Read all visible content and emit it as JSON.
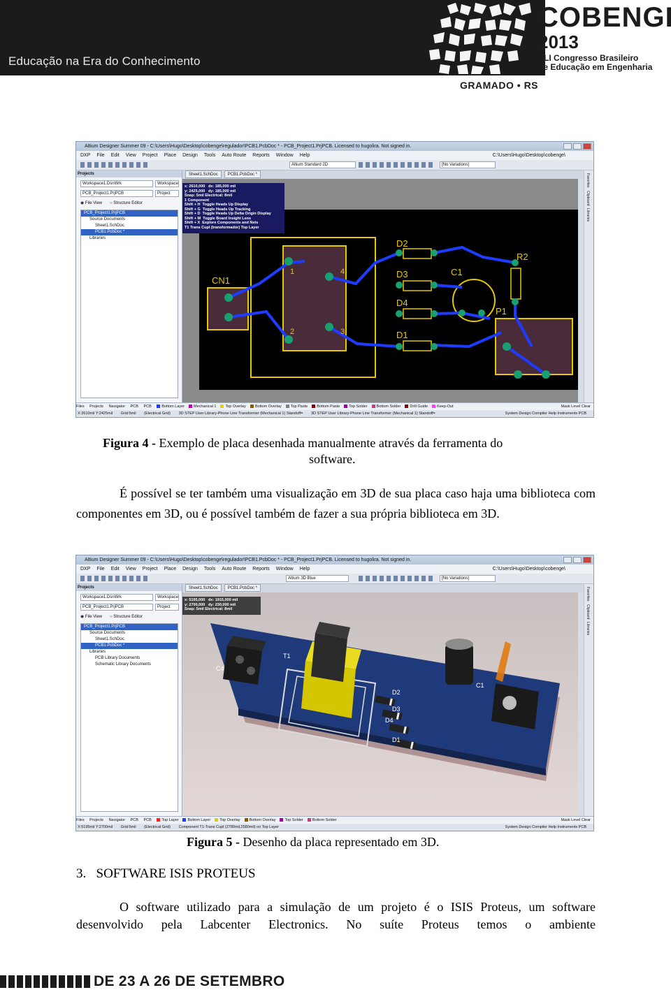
{
  "header": {
    "tagline": "Educação na Era do Conhecimento",
    "brand": "COBENGE",
    "year": "2013",
    "congress_line1": "XLI Congresso Brasileiro",
    "congress_line2": "de Educação em Engenharia",
    "city": "GRAMADO • RS"
  },
  "figure4": {
    "caption_label": "Figura 4 -",
    "caption_text": " Exemplo de placa desenhada manualmente através da ferramenta do",
    "caption_cont": "software.",
    "window_title": "Altium Designer Summer 09 - C:\\Users\\Hugo\\Desktop\\cobenge\\regulador\\PCB1.PcbDoc * - PCB_Project1.PrjPCB. Licensed to hugolira. Not signed in.",
    "menu": [
      "DXP",
      "File",
      "Edit",
      "View",
      "Project",
      "Place",
      "Design",
      "Tools",
      "Auto Route",
      "Reports",
      "Window",
      "Help"
    ],
    "path": "C:\\Users\\Hugo\\Desktop\\cobenge\\",
    "view_combo": "Altium Standard 2D",
    "variations": "[No Variations]",
    "panel_title": "Projects",
    "workspace": "Workspace1.DsnWrk",
    "workspace_btn": "Workspace",
    "project": "PCB_Project1.PrjPCB",
    "project_btn": "Project",
    "file_view": "File View",
    "structure_editor": "Structure Editor",
    "tree": [
      "PCB_Project1.PrjPCB",
      "Source Documents",
      "Sheet1.SchDoc",
      "PCB1.PcbDoc *",
      "Libraries"
    ],
    "tabs": [
      "Sheet1.SchDoc",
      "PCB1.PcbDoc *"
    ],
    "hud": "x: 2610,000   dx: 185,000 mil\ny: 2425,000   dy: 185,000 mil\nSnap: 5mil Electrical: 8mil\n1 Component\nShift + H  Toggle Heads Up Display\nShift + G  Toggle Heads Up Tracking\nShift + D  Toggle Heads Up Delta Origin Display\nShift + M  Toggle Board Insight Lens\nShift + X  Explore Components and Nets\nT1 Trans Cupl (transformador) Top Layer",
    "designators": [
      "CN1",
      "D2",
      "D3",
      "D4",
      "D1",
      "C1",
      "R2",
      "P1",
      "1",
      "2",
      "3",
      "4"
    ],
    "rail": [
      "Favorites",
      "Clipboard",
      "Libraries"
    ],
    "bottom_tabs": [
      "Files",
      "Projects",
      "Navigator",
      "PCB",
      "PCB"
    ],
    "layers": [
      {
        "name": "Bottom Layer",
        "color": "#1e3cff"
      },
      {
        "name": "Mechanical 1",
        "color": "#c000c0"
      },
      {
        "name": "Top Overlay",
        "color": "#e8d000"
      },
      {
        "name": "Bottom Overlay",
        "color": "#8a5a00"
      },
      {
        "name": "Top Paste",
        "color": "#808080"
      },
      {
        "name": "Bottom Paste",
        "color": "#800000"
      },
      {
        "name": "Top Solder",
        "color": "#a000a0"
      },
      {
        "name": "Bottom Solder",
        "color": "#c04080"
      },
      {
        "name": "Drill Guide",
        "color": "#900000"
      },
      {
        "name": "Keep-Out",
        "color": "#ff40ff"
      }
    ],
    "layerbar_right": "Mask Level   Clear",
    "status": [
      "X:2610mil Y:2425mil",
      "Grid:5mil",
      "(Electrical Grid)",
      "3D STEP User Library-Phone Line Transformer (Mechanical 1) Standoff=",
      "3D STEP User Library-Phone Line Transformer (Mechanical 1) Standoff="
    ],
    "status_right": "System   Design Compiler   Help   Instruments   PCB"
  },
  "paragraph1": "É possível se ter também uma visualização em 3D de sua placa caso haja uma biblioteca com componentes em 3D, ou é possível também de fazer a sua própria biblioteca em 3D.",
  "figure5": {
    "caption_label": "Figura 5 -",
    "caption_text": "  Desenho da placa representado em 3D.",
    "window_title": "Altium Designer Summer 09 - C:\\Users\\Hugo\\Desktop\\cobenge\\regulador\\PCB1.PcbDoc * - PCB_Project1.PrjPCB. Licensed to hugolira. Not signed in.",
    "view_combo": "Altium 3D Blue",
    "tree": [
      "PCB_Project1.PrjPCB",
      "Source Documents",
      "Sheet1.SchDoc",
      "PCB1.PcbDoc *",
      "Libraries",
      "PCB Library Documents",
      "Schematic Library Documents"
    ],
    "hud": "x: 5195,000   dx: 1915,000 mil\ny: 2700,000   dy: 230,000 mil\nSnap: 5mil Electrical: 8mil",
    "labels_3d": [
      "T1",
      "C4",
      "D2",
      "D3",
      "D4",
      "D1",
      "C1"
    ],
    "layers": [
      {
        "name": "Top Layer",
        "color": "#ff2020"
      },
      {
        "name": "Bottom Layer",
        "color": "#1e3cff"
      },
      {
        "name": "Top Overlay",
        "color": "#e8d000"
      },
      {
        "name": "Bottom Overlay",
        "color": "#8a5a00"
      },
      {
        "name": "Top Solder",
        "color": "#a000a0"
      },
      {
        "name": "Bottom Solder",
        "color": "#c04080"
      }
    ],
    "status": [
      "X:5195mil Y:2700mil",
      "Grid:5mil",
      "(Electrical Grid)",
      "Component T1-Trans Cupl (2780mil,2580mil) on Top Layer"
    ]
  },
  "section": {
    "number": "3.",
    "title": "SOFTWARE ISIS PROTEUS"
  },
  "paragraph2": "O software utilizado para a simulação de um projeto é o ISIS Proteus, um software desenvolvido pela Labcenter Electronics. No suíte Proteus temos o ambiente",
  "footer": {
    "date": "DE 23 A 26 DE SETEMBRO"
  }
}
